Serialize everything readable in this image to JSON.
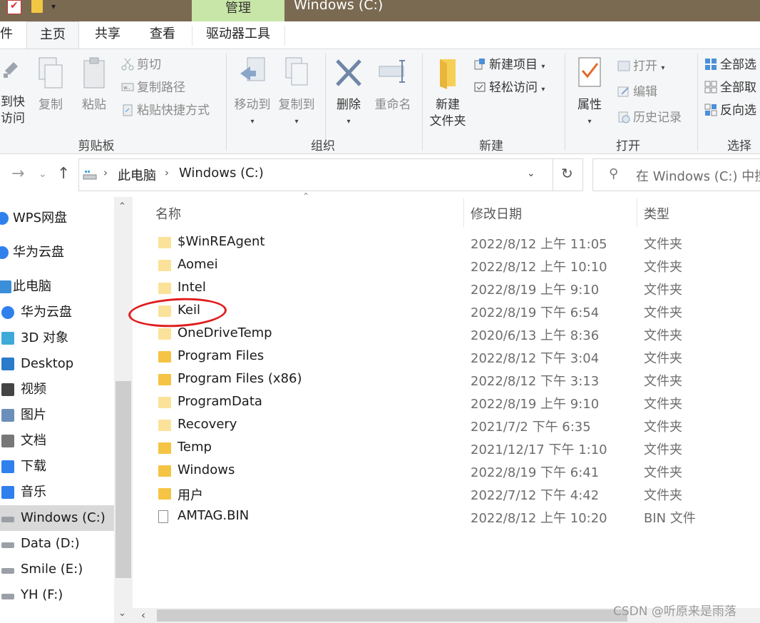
{
  "title_bar": {
    "context_tab": "管理",
    "window_title": "Windows (C:)"
  },
  "tabs": {
    "file_partial": "件",
    "home": "主页",
    "share": "共享",
    "view": "查看",
    "drive_tools": "驱动器工具"
  },
  "ribbon": {
    "clipboard": {
      "pin_line1": "到快",
      "pin_line2": "访问",
      "copy": "复制",
      "paste": "粘贴",
      "cut": "剪切",
      "copy_path": "复制路径",
      "paste_shortcut": "粘贴快捷方式",
      "group_label": "剪贴板"
    },
    "organize": {
      "move_to": "移动到",
      "copy_to": "复制到",
      "delete": "删除",
      "rename": "重命名",
      "group_label": "组织"
    },
    "new": {
      "new_folder_line1": "新建",
      "new_folder_line2": "文件夹",
      "new_item": "新建项目",
      "easy_access": "轻松访问",
      "group_label": "新建"
    },
    "open": {
      "properties": "属性",
      "open": "打开",
      "edit": "编辑",
      "history": "历史记录",
      "group_label": "打开"
    },
    "select": {
      "select_all": "全部选",
      "select_none": "全部取",
      "invert": "反向选",
      "group_label": "选择"
    }
  },
  "address": {
    "crumb_this_pc": "此电脑",
    "crumb_drive": "Windows (C:)",
    "search_placeholder": "在 Windows (C:) 中搜"
  },
  "nav_pane": {
    "items": [
      {
        "label": "WPS网盘",
        "icon": "cloud-icon"
      },
      {
        "label": "华为云盘",
        "icon": "cloud-icon"
      },
      {
        "label": "此电脑",
        "icon": "computer-icon"
      },
      {
        "label": "华为云盘",
        "icon": "cloud-icon"
      },
      {
        "label": "3D 对象",
        "icon": "cube-icon"
      },
      {
        "label": "Desktop",
        "icon": "desktop-icon"
      },
      {
        "label": "视频",
        "icon": "video-icon"
      },
      {
        "label": "图片",
        "icon": "picture-icon"
      },
      {
        "label": "文档",
        "icon": "document-icon"
      },
      {
        "label": "下载",
        "icon": "download-icon"
      },
      {
        "label": "音乐",
        "icon": "music-icon"
      },
      {
        "label": "Windows (C:)",
        "icon": "drive-icon"
      },
      {
        "label": "Data (D:)",
        "icon": "drive-icon"
      },
      {
        "label": "Smile (E:)",
        "icon": "drive-icon"
      },
      {
        "label": "YH (F:)",
        "icon": "drive-icon"
      }
    ],
    "selected": "Windows (C:)"
  },
  "columns": {
    "name": "名称",
    "modified": "修改日期",
    "type": "类型"
  },
  "files": [
    {
      "name": "$WinREAgent",
      "date": "2022/8/12 上午 11:05",
      "type": "文件夹",
      "kind": "folder-light"
    },
    {
      "name": "Aomei",
      "date": "2022/8/12 上午 10:10",
      "type": "文件夹",
      "kind": "folder-light"
    },
    {
      "name": "Intel",
      "date": "2022/8/19 上午 9:10",
      "type": "文件夹",
      "kind": "folder-light"
    },
    {
      "name": "Keil",
      "date": "2022/8/19 下午 6:54",
      "type": "文件夹",
      "kind": "folder-light"
    },
    {
      "name": "OneDriveTemp",
      "date": "2020/6/13 上午 8:36",
      "type": "文件夹",
      "kind": "folder-light"
    },
    {
      "name": "Program Files",
      "date": "2022/8/12 下午 3:04",
      "type": "文件夹",
      "kind": "folder"
    },
    {
      "name": "Program Files (x86)",
      "date": "2022/8/12 下午 3:13",
      "type": "文件夹",
      "kind": "folder"
    },
    {
      "name": "ProgramData",
      "date": "2022/8/19 上午 9:10",
      "type": "文件夹",
      "kind": "folder-light"
    },
    {
      "name": "Recovery",
      "date": "2021/7/2 下午 6:35",
      "type": "文件夹",
      "kind": "folder-light"
    },
    {
      "name": "Temp",
      "date": "2021/12/17 下午 1:10",
      "type": "文件夹",
      "kind": "folder"
    },
    {
      "name": "Windows",
      "date": "2022/8/19 下午 6:41",
      "type": "文件夹",
      "kind": "folder"
    },
    {
      "name": "用户",
      "date": "2022/7/12 下午 4:42",
      "type": "文件夹",
      "kind": "folder"
    },
    {
      "name": "AMTAG.BIN",
      "date": "2022/8/12 上午 10:20",
      "type": "BIN 文件",
      "kind": "file"
    }
  ],
  "annotation": {
    "highlighted_item": "Keil",
    "color": "#e01d1d"
  },
  "watermark": "CSDN @听原来是雨落",
  "colors": {
    "title_bar": "#7a6a52",
    "context_tab": "#c8e6a7",
    "ribbon": "#f5f6f7",
    "selected_nav": "#d9d9d9"
  }
}
